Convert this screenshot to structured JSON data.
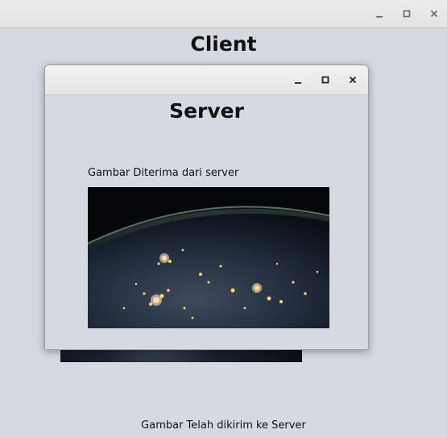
{
  "client_window": {
    "title": "Client",
    "status_text": "Gambar Telah dikirim ke Server",
    "controls": [
      "minimize-icon",
      "maximize-icon",
      "close-icon"
    ]
  },
  "server_window": {
    "title": "Server",
    "image_label": "Gambar Diterima dari server",
    "image_description_icon": "earth-at-night-image",
    "controls": [
      "minimize-icon",
      "maximize-icon",
      "close-icon"
    ]
  },
  "colors": {
    "window_background": "#d6d9e0",
    "titlebar": "#e8e8e8",
    "text": "#111111"
  }
}
